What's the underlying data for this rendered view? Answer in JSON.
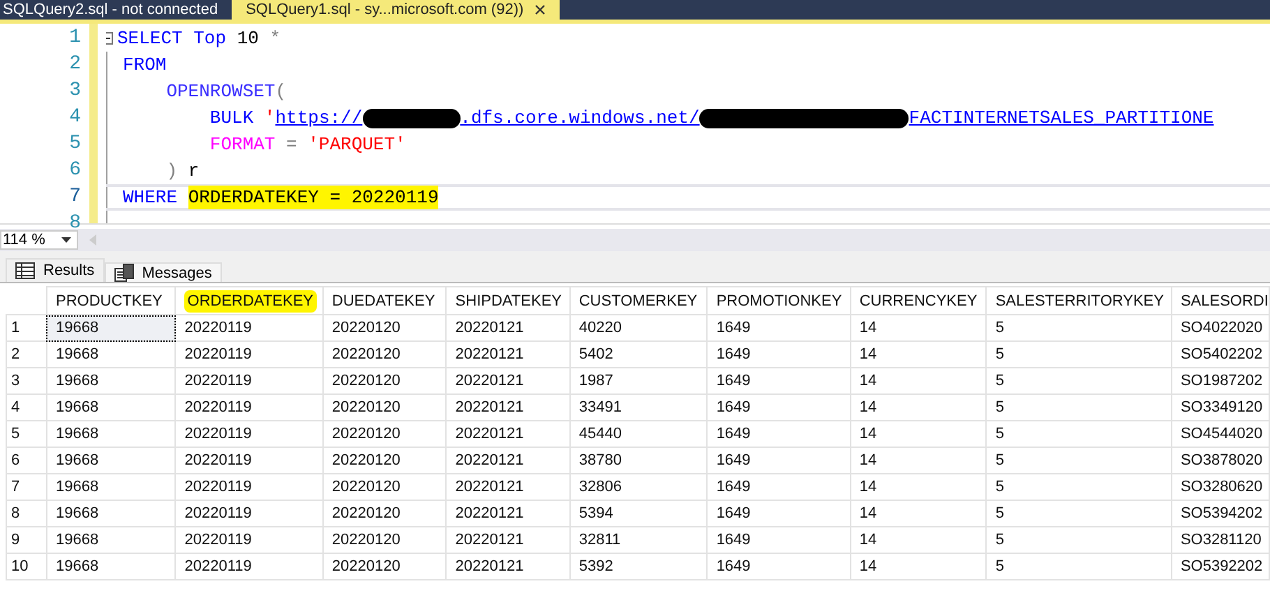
{
  "doc_tabs": [
    {
      "title": "SQLQuery2.sql - not connected",
      "selected": false
    },
    {
      "title": "SQLQuery1.sql - sy...microsoft.com (92))",
      "selected": true
    }
  ],
  "editor": {
    "lines": [
      {
        "number": "1",
        "current": false,
        "collapsible": true,
        "tokens": [
          {
            "kind": "keyword",
            "text": "SELECT Top"
          },
          {
            "kind": "plain",
            "text": " 10 "
          },
          {
            "kind": "operator",
            "text": "*"
          }
        ]
      },
      {
        "number": "2",
        "current": false,
        "collapsible": false,
        "tokens": [
          {
            "kind": "keyword",
            "text": "FROM"
          }
        ]
      },
      {
        "number": "3",
        "current": false,
        "collapsible": false,
        "tokens": [
          {
            "kind": "function",
            "text": "    OPENROWSET"
          },
          {
            "kind": "operator",
            "text": "("
          }
        ]
      },
      {
        "number": "4",
        "current": false,
        "collapsible": false,
        "tokens": [
          {
            "kind": "keyword",
            "text": "        BULK"
          },
          {
            "kind": "string",
            "text": " '"
          },
          {
            "kind": "link",
            "text": "https://"
          },
          {
            "kind": "redacted"
          },
          {
            "kind": "link",
            "text": ".dfs.core.windows.net/"
          },
          {
            "kind": "redacted"
          },
          {
            "kind": "link",
            "text": "FACTINTERNETSALES_PARTITIONE"
          }
        ]
      },
      {
        "number": "5",
        "current": false,
        "collapsible": false,
        "tokens": [
          {
            "kind": "system",
            "text": "        FORMAT"
          },
          {
            "kind": "operator",
            "text": " = "
          },
          {
            "kind": "string",
            "text": "'PARQUET'"
          }
        ]
      },
      {
        "number": "6",
        "current": false,
        "collapsible": false,
        "tokens": [
          {
            "kind": "operator",
            "text": "    )"
          },
          {
            "kind": "plain",
            "text": " r"
          }
        ]
      },
      {
        "number": "7",
        "current": true,
        "collapsible": false,
        "tokens": [
          {
            "kind": "keyword",
            "text": "WHERE "
          },
          {
            "kind": "highlight",
            "text": "ORDERDATEKEY = 20220119"
          }
        ]
      },
      {
        "number": "8",
        "current": false,
        "collapsible": false
      }
    ]
  },
  "zoom": {
    "value": "114 %"
  },
  "result_tabs": [
    {
      "label": "Results",
      "selected": true
    },
    {
      "label": "Messages",
      "selected": false
    }
  ],
  "grid": {
    "columns": [
      {
        "label": "PRODUCTKEY",
        "highlighted": false
      },
      {
        "label": "ORDERDATEKEY",
        "highlighted": true
      },
      {
        "label": "DUEDATEKEY",
        "highlighted": false
      },
      {
        "label": "SHIPDATEKEY",
        "highlighted": false
      },
      {
        "label": "CUSTOMERKEY",
        "highlighted": false
      },
      {
        "label": "PROMOTIONKEY",
        "highlighted": false
      },
      {
        "label": "CURRENCYKEY",
        "highlighted": false
      },
      {
        "label": "SALESTERRITORYKEY",
        "highlighted": false
      },
      {
        "label": "SALESORDI",
        "highlighted": false
      }
    ],
    "rows": [
      {
        "number": "1",
        "selected": true,
        "cells": [
          "19668",
          "20220119",
          "20220120",
          "20220121",
          "40220",
          "1649",
          "14",
          "5",
          "SO4022020"
        ]
      },
      {
        "number": "2",
        "selected": false,
        "cells": [
          "19668",
          "20220119",
          "20220120",
          "20220121",
          "5402",
          "1649",
          "14",
          "5",
          "SO5402202"
        ]
      },
      {
        "number": "3",
        "selected": false,
        "cells": [
          "19668",
          "20220119",
          "20220120",
          "20220121",
          "1987",
          "1649",
          "14",
          "5",
          "SO1987202"
        ]
      },
      {
        "number": "4",
        "selected": false,
        "cells": [
          "19668",
          "20220119",
          "20220120",
          "20220121",
          "33491",
          "1649",
          "14",
          "5",
          "SO3349120"
        ]
      },
      {
        "number": "5",
        "selected": false,
        "cells": [
          "19668",
          "20220119",
          "20220120",
          "20220121",
          "45440",
          "1649",
          "14",
          "5",
          "SO4544020"
        ]
      },
      {
        "number": "6",
        "selected": false,
        "cells": [
          "19668",
          "20220119",
          "20220120",
          "20220121",
          "38780",
          "1649",
          "14",
          "5",
          "SO3878020"
        ]
      },
      {
        "number": "7",
        "selected": false,
        "cells": [
          "19668",
          "20220119",
          "20220120",
          "20220121",
          "32806",
          "1649",
          "14",
          "5",
          "SO3280620"
        ]
      },
      {
        "number": "8",
        "selected": false,
        "cells": [
          "19668",
          "20220119",
          "20220120",
          "20220121",
          "5394",
          "1649",
          "14",
          "5",
          "SO5394202"
        ]
      },
      {
        "number": "9",
        "selected": false,
        "cells": [
          "19668",
          "20220119",
          "20220120",
          "20220121",
          "32811",
          "1649",
          "14",
          "5",
          "SO3281120"
        ]
      },
      {
        "number": "10",
        "selected": false,
        "cells": [
          "19668",
          "20220119",
          "20220120",
          "20220121",
          "5392",
          "1649",
          "14",
          "5",
          "SO5392202"
        ]
      }
    ]
  }
}
